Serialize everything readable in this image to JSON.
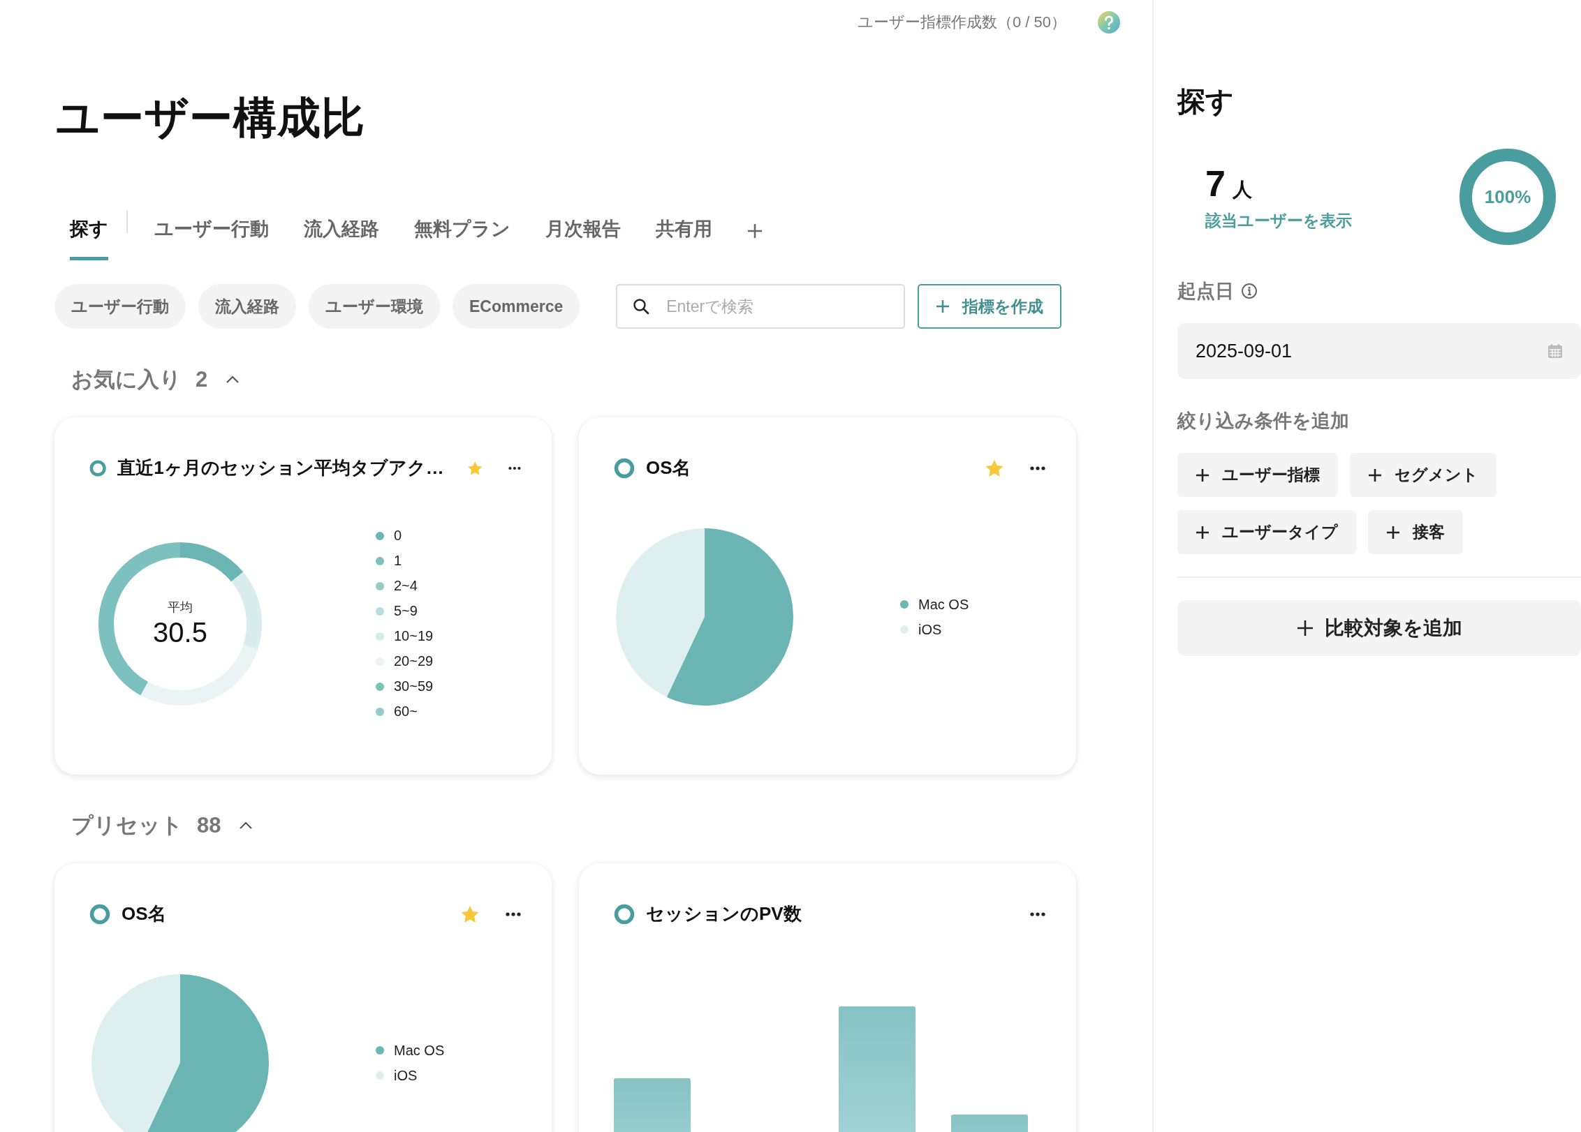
{
  "header": {
    "usage": "ユーザー指標作成数（0 / 50）"
  },
  "page_title": "ユーザー構成比",
  "tabs": [
    {
      "label": "探す",
      "selected": true
    },
    {
      "label": "ユーザー行動",
      "selected": false
    },
    {
      "label": "流入経路",
      "selected": false
    },
    {
      "label": "無料プラン",
      "selected": false
    },
    {
      "label": "月次報告",
      "selected": false
    },
    {
      "label": "共有用",
      "selected": false
    }
  ],
  "filter_chips": [
    "ユーザー行動",
    "流入経路",
    "ユーザー環境",
    "ECommerce"
  ],
  "search": {
    "placeholder": "Enterで検索"
  },
  "create_button": "指標を作成",
  "sections": [
    {
      "label": "お気に入り",
      "count": "2",
      "expanded": true,
      "cards": [
        {
          "kind": "donut",
          "title": "直近1ヶ月のセッション平均タブアク…",
          "favorite": true,
          "center_label": "平均",
          "center_value": "30.5",
          "legend": [
            {
              "label": "0",
              "color": "#6bb5b5"
            },
            {
              "label": "1",
              "color": "#7cc0c0"
            },
            {
              "label": "2~4",
              "color": "#93cbcb"
            },
            {
              "label": "5~9",
              "color": "#b8dddd"
            },
            {
              "label": "10~19",
              "color": "#d6ebeb"
            },
            {
              "label": "20~29",
              "color": "#eaf4f4"
            },
            {
              "label": "30~59",
              "color": "#7cc0c0"
            },
            {
              "label": "60~",
              "color": "#93cbcb"
            }
          ]
        },
        {
          "kind": "pie",
          "title": "OS名",
          "favorite": true,
          "legend": [
            {
              "label": "Mac OS",
              "color": "#6bb5b5"
            },
            {
              "label": "iOS",
              "color": "#deeff0"
            }
          ]
        }
      ]
    },
    {
      "label": "プリセット",
      "count": "88",
      "expanded": true,
      "cards": [
        {
          "kind": "pie",
          "title": "OS名",
          "favorite": true,
          "legend": [
            {
              "label": "Mac OS",
              "color": "#6bb5b5"
            },
            {
              "label": "iOS",
              "color": "#deeff0"
            }
          ]
        },
        {
          "kind": "bar",
          "title": "セッションのPV数",
          "favorite": false
        }
      ]
    }
  ],
  "side_panel": {
    "title": "探す",
    "count": "7",
    "unit": "人",
    "link": "該当ユーザーを表示",
    "ratio": "100%",
    "start_date_label": "起点日",
    "start_date": "2025-09-01",
    "filter_label": "絞り込み条件を追加",
    "filter_buttons": [
      "ユーザー指標",
      "セグメント",
      "ユーザータイプ",
      "接客"
    ],
    "compare_button": "比較対象を追加"
  }
}
